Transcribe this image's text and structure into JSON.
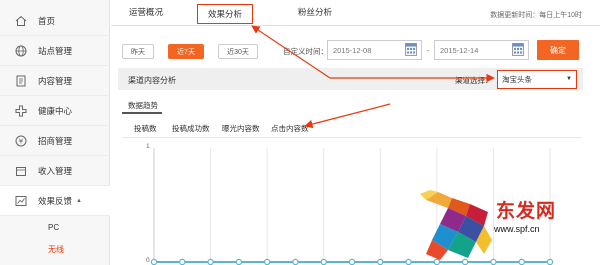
{
  "sidebar": {
    "items": [
      {
        "label": "首页",
        "icon": "home-icon"
      },
      {
        "label": "站点管理",
        "icon": "globe-icon"
      },
      {
        "label": "内容管理",
        "icon": "document-icon"
      },
      {
        "label": "健康中心",
        "icon": "plus-icon"
      },
      {
        "label": "招商管理",
        "icon": "coin-icon"
      },
      {
        "label": "收入管理",
        "icon": "wallet-icon"
      },
      {
        "label": "效果反馈",
        "icon": "chart-icon"
      }
    ],
    "sub_items": [
      {
        "label": "PC"
      },
      {
        "label": "无线"
      }
    ]
  },
  "top_tabs": [
    {
      "label": "运营概况"
    },
    {
      "label": "效果分析"
    },
    {
      "label": "粉丝分析"
    }
  ],
  "update_time": "数据更新时间：每日上午10时",
  "date_range": {
    "presets": [
      "昨天",
      "近7天",
      "近30天"
    ],
    "custom_label": "自定义时间：",
    "start": "2015-12-08",
    "separator": "-",
    "end": "2015-12-14",
    "confirm": "确定"
  },
  "channel_analysis": {
    "title": "渠道内容分析",
    "select_label": "渠道选择：",
    "selected": "淘宝头条"
  },
  "data_trend": {
    "title": "数据趋势",
    "tabs": [
      "投稿数",
      "投稿成功数",
      "曝光内容数",
      "点击内容数"
    ]
  },
  "chart_data": {
    "type": "line",
    "title": "",
    "xlabel": "",
    "ylabel": "",
    "ylim": [
      0,
      1
    ],
    "y_ticks": [
      "1",
      "0"
    ],
    "series": [
      {
        "values": [
          0,
          0,
          0,
          0,
          0,
          0,
          0,
          0,
          0,
          0,
          0,
          0,
          0,
          0,
          0
        ],
        "color": "#5bb4d8"
      }
    ]
  },
  "watermark": {
    "logo": "东发网",
    "url": "www.spf.cn"
  },
  "colors": {
    "accent": "#f26522",
    "highlight": "#e8380d",
    "line": "#5bb4d8"
  }
}
